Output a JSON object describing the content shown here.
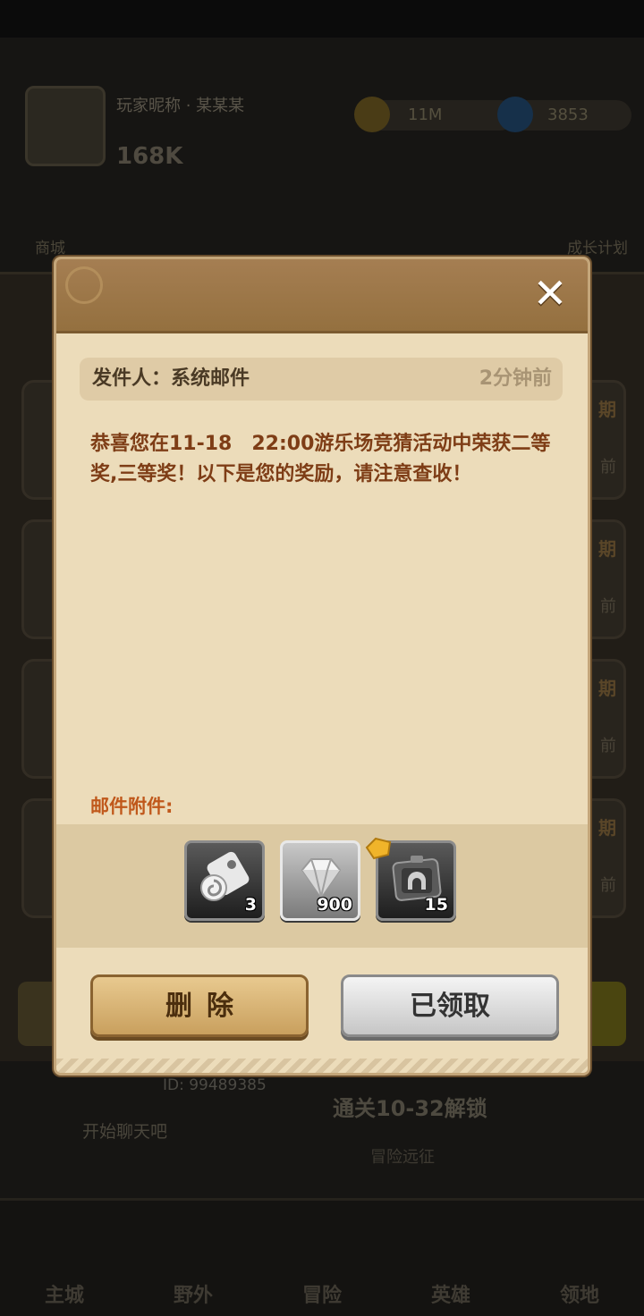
{
  "background": {
    "player_name": "玩家昵称 · 某某某",
    "power": "168K",
    "gold": "11M",
    "gems": "3853",
    "side_left": "商城",
    "side_right": "成长计划",
    "cards": [
      {
        "tag": "期",
        "sub": "前"
      },
      {
        "tag": "期",
        "sub": "前"
      },
      {
        "tag": "期",
        "sub": "前"
      },
      {
        "tag": "期",
        "sub": "前"
      }
    ],
    "chat_id": "ID: 99489385",
    "chat_prompt": "开始聊天吧",
    "stage": "通关10-32解锁",
    "stage_sub": "冒险远征",
    "nav": [
      "主城",
      "野外",
      "冒险",
      "英雄",
      "领地"
    ]
  },
  "dialog": {
    "sender_label": "发件人：系统邮件",
    "time": "2分钟前",
    "body": "恭喜您在11-18　22:00游乐场竞猜活动中荣获二等奖,三等奖！以下是您的奖励，请注意查收！",
    "attachments_label": "邮件附件:",
    "attachments": [
      {
        "icon": "scroll-icon",
        "count": "3"
      },
      {
        "icon": "diamond-icon",
        "count": "900"
      },
      {
        "icon": "helmet-token-icon",
        "count": "15"
      }
    ],
    "delete_label": "删除",
    "claimed_label": "已领取",
    "close_symbol": "✕"
  },
  "colors": {
    "dialog_bg": "#ecdcba",
    "header_bg": "#a57e52",
    "body_text": "#7e3d16",
    "attach_label": "#c0581b",
    "delete_button": "#d9b57a",
    "claimed_button": "#dcdcdc"
  }
}
